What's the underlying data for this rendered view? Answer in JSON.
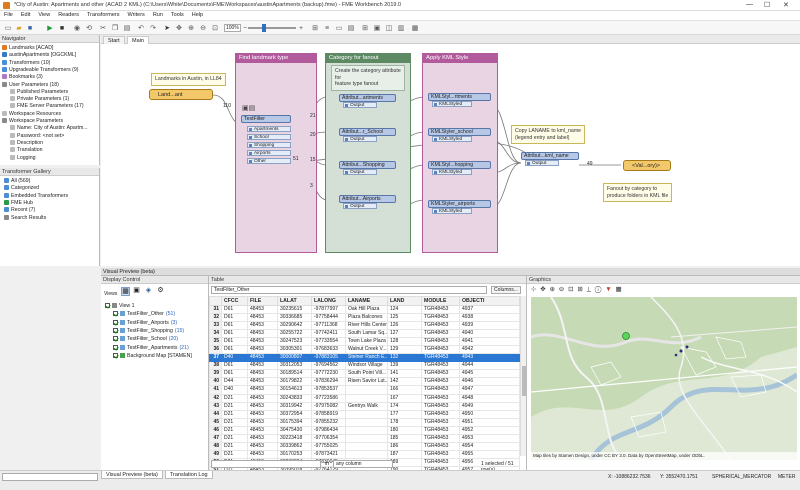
{
  "window": {
    "title": "*City of Austin: Apartments and other (ACAD 2 KML) (C:\\Users\\White\\Documents\\FME\\Workspaces\\austinApartments (backup).fmw) - FME Workbench 2019.0",
    "min": "—",
    "max": "☐",
    "close": "✕"
  },
  "menu": [
    "File",
    "Edit",
    "View",
    "Readers",
    "Transformers",
    "Writers",
    "Run",
    "Tools",
    "Help"
  ],
  "toolbar": {
    "zoom": "100%"
  },
  "navigator": {
    "header": "Navigator",
    "items": [
      {
        "label": "Landmarks [ACAD]",
        "color": "#e07a1f"
      },
      {
        "label": "austinApartments [OGCKML]",
        "color": "#3a78c8"
      },
      {
        "label": "Transformers (10)",
        "color": "#4a8fd6"
      },
      {
        "label": "Upgradeable Transformers (9)",
        "color": "#4a8fd6"
      },
      {
        "label": "Bookmarks (3)",
        "color": "#b07ac0"
      },
      {
        "label": "User Parameters (18)",
        "color": "#8a8a8a"
      },
      {
        "label": "Published Parameters",
        "color": "#bbbbbb"
      },
      {
        "label": "Private Parameters (1)",
        "color": "#bbbbbb"
      },
      {
        "label": "FME Server Parameters (17)",
        "color": "#bbbbbb"
      },
      {
        "label": "Workspace Resources",
        "color": "#bbbbbb"
      },
      {
        "label": "Workspace Parameters",
        "color": "#8a8a8a"
      },
      {
        "label": "Name: City of Austin: Apartm...",
        "color": "#bbbbbb"
      },
      {
        "label": "Password: <not set>",
        "color": "#bbbbbb"
      },
      {
        "label": "Description",
        "color": "#bbbbbb"
      },
      {
        "label": "Translation",
        "color": "#bbbbbb"
      },
      {
        "label": "Logging",
        "color": "#bbbbbb"
      }
    ]
  },
  "gallery": {
    "header": "Transformer Gallery",
    "items": [
      "All (569)",
      "Categorized",
      "Embedded Transformers",
      "FME Hub",
      "Recent (7)",
      "Search Results"
    ]
  },
  "canvas": {
    "tabs": [
      "Start",
      "Main"
    ],
    "note_reader": "Landmarks in Austin, in LL84",
    "reader_label": "Land...ant",
    "count_110": "110",
    "bookmarks": [
      {
        "title": "Find landmark type",
        "color": "#b15b9d",
        "fill": "#e9d4e4"
      },
      {
        "title": "Category for fanout",
        "color": "#5d8a63",
        "fill": "#d4e0d5"
      },
      {
        "title": "Apply KML Style",
        "color": "#b15b9d",
        "fill": "#e9d4e4"
      }
    ],
    "testfilter": {
      "name": "TestFilter",
      "ports": [
        "Apartments",
        "School",
        "Shopping",
        "Airports",
        "Other"
      ]
    },
    "note_category": "Create the category attribute\nfor\nfeature type fanout",
    "attr_creators": [
      "Attribut...artments",
      "Attribut...r_School",
      "Attribut...Shopping",
      "Attribut...Airports"
    ],
    "kml_stylers": [
      "KMLStyl...rtments",
      "KMLStyler_school",
      "KMLStyl...hopping",
      "KMLStyler_airports"
    ],
    "port_output": "Output",
    "port_kmlstyled": "KMLStyled",
    "counts": [
      "21",
      "20",
      "15",
      "3",
      "51"
    ],
    "note_copy": "Copy LANAME to kml_name\n(legend entry and label)",
    "attr_kml": "Attribut...kml_name",
    "writer_label": "<Val...ory)>",
    "count_49": "49",
    "note_fanout": "Fanout by category to\nproduce folders in KML file"
  },
  "visual_preview": {
    "header": "Visual Preview (beta)",
    "display_control": "Display Control",
    "views_label": "Views",
    "layers": [
      {
        "label": "View 1",
        "count": ""
      },
      {
        "label": "TestFilter_Other",
        "count": "(51)"
      },
      {
        "label": "TestFilter_Airports",
        "count": "(3)"
      },
      {
        "label": "TestFilter_Shopping",
        "count": "(15)"
      },
      {
        "label": "TestFilter_School",
        "count": "(20)"
      },
      {
        "label": "TestFilter_Apartments",
        "count": "(21)"
      },
      {
        "label": "Background Map [STAMEN]",
        "count": ""
      }
    ],
    "table_label": "Table",
    "table_source": "TestFilter_Other",
    "columns_button": "Columns...",
    "headers": [
      "",
      "CFCC",
      "FILE",
      "LALAT",
      "LALONG",
      "LANAME",
      "LAND",
      "MODULE",
      "OBJECTI"
    ],
    "rows": [
      [
        "31",
        "D61",
        "48453",
        "30235615",
        "-97877997",
        "Oak Hill Plaza",
        "124",
        "TGR48453",
        "4937"
      ],
      [
        "32",
        "D61",
        "48453",
        "30336685",
        "-97758444",
        "Plaza Balcones",
        "125",
        "TGR48453",
        "4938"
      ],
      [
        "33",
        "D61",
        "48453",
        "30290642",
        "-97711368",
        "River Hills Center",
        "126",
        "TGR48453",
        "4939"
      ],
      [
        "34",
        "D61",
        "48453",
        "30255722",
        "-97742411",
        "South Lamar Sq...",
        "127",
        "TGR48453",
        "4940"
      ],
      [
        "35",
        "D61",
        "48453",
        "30247523",
        "-97733554",
        "Town Lake Plaza",
        "128",
        "TGR48453",
        "4941"
      ],
      [
        "36",
        "D61",
        "48453",
        "30305301",
        "-97683633",
        "Walnut Creek V...",
        "129",
        "TGR48453",
        "4942"
      ],
      [
        "37",
        "D40",
        "48453",
        "30000807",
        "-97883105",
        "Steiner Ranch E...",
        "132",
        "TGR48453",
        "4943"
      ],
      [
        "38",
        "D61",
        "48453",
        "30312053",
        "-97694562",
        "Windsor Village",
        "139",
        "TGR48453",
        "4944"
      ],
      [
        "39",
        "D61",
        "48453",
        "30189514",
        "-97772230",
        "South Point Vill...",
        "141",
        "TGR48453",
        "4945"
      ],
      [
        "40",
        "D44",
        "48453",
        "30179822",
        "-97836294",
        "Risen Savior Lut...",
        "142",
        "TGR48453",
        "4946"
      ],
      [
        "41",
        "D40",
        "48453",
        "30154613",
        "-97853537",
        "",
        "166",
        "TGR48453",
        "4947"
      ],
      [
        "42",
        "D21",
        "48453",
        "30243833",
        "-97723586",
        "",
        "167",
        "TGR48453",
        "4948"
      ],
      [
        "43",
        "D21",
        "48453",
        "30319942",
        "-97975082",
        "Gentrys Walk",
        "174",
        "TGR48453",
        "4949"
      ],
      [
        "44",
        "D21",
        "48453",
        "30372954",
        "-97858919",
        "",
        "177",
        "TGR48453",
        "4950"
      ],
      [
        "45",
        "D21",
        "48453",
        "30175394",
        "-97855232",
        "",
        "178",
        "TGR48453",
        "4951"
      ],
      [
        "46",
        "D21",
        "48453",
        "30475430",
        "-97986434",
        "",
        "180",
        "TGR48453",
        "4952"
      ],
      [
        "47",
        "D21",
        "48453",
        "30223418",
        "-97706354",
        "",
        "185",
        "TGR48453",
        "4953"
      ],
      [
        "48",
        "D21",
        "48453",
        "30339862",
        "-97755025",
        "",
        "186",
        "TGR48453",
        "4954"
      ],
      [
        "49",
        "D21",
        "48453",
        "30170253",
        "-97873421",
        "",
        "187",
        "TGR48453",
        "4955"
      ],
      [
        "50",
        "D21",
        "48453",
        "30208824",
        "-97830045",
        "",
        "189",
        "TGR48453",
        "4956"
      ],
      [
        "51",
        "D21",
        "48453",
        "30395018",
        "-97764129",
        "",
        "190",
        "TGR48453",
        "4957"
      ]
    ],
    "selected_row": 6,
    "search_in": "in",
    "search_scope": "any column",
    "status": "1 selected / 51 row(s)",
    "graphics_label": "Graphics",
    "map_credit": "Map tiles by Stamen Design, under CC BY 3.0. Data by OpenStreetMap, under ODbL.",
    "coord_x": "X: -10886232.7536",
    "coord_y": "Y: 3552470.1751",
    "projection": "SPHERICAL_MERCATOR",
    "units": "METER"
  },
  "bottom_tabs": [
    "Visual Preview (beta)",
    "Translation Log"
  ]
}
